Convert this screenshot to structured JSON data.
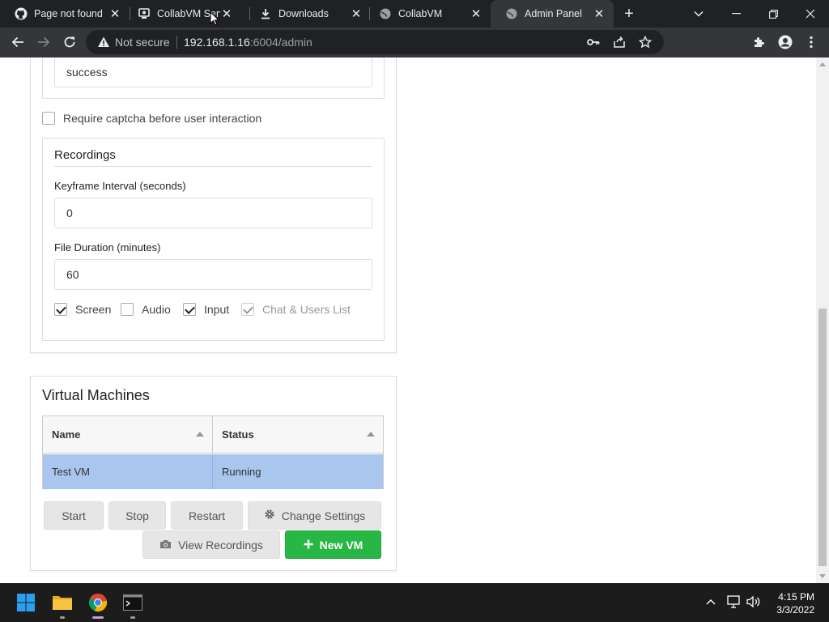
{
  "browser": {
    "tabs": [
      {
        "title": "Page not found",
        "icon": "github-icon"
      },
      {
        "title": "CollabVM Server",
        "icon": "collabvm-icon"
      },
      {
        "title": "Downloads",
        "icon": "download-icon"
      },
      {
        "title": "CollabVM",
        "icon": "globe-icon"
      },
      {
        "title": "Admin Panel",
        "icon": "globe-icon",
        "active": true
      }
    ],
    "not_secure": "Not secure",
    "url_host": "192.168.1.16",
    "url_rest": ":6004/admin"
  },
  "settings": {
    "auth_result_value": "success",
    "captcha_label": "Require captcha before user interaction",
    "captcha_checked": false
  },
  "recordings": {
    "title": "Recordings",
    "keyframe_label": "Keyframe Interval (seconds)",
    "keyframe_value": "0",
    "duration_label": "File Duration (minutes)",
    "duration_value": "60",
    "options": [
      {
        "label": "Screen",
        "checked": true,
        "disabled": false
      },
      {
        "label": "Audio",
        "checked": false,
        "disabled": false
      },
      {
        "label": "Input",
        "checked": true,
        "disabled": false
      },
      {
        "label": "Chat & Users List",
        "checked": true,
        "disabled": true
      }
    ]
  },
  "vms": {
    "title": "Virtual Machines",
    "columns": [
      "Name",
      "Status"
    ],
    "rows": [
      {
        "name": "Test VM",
        "status": "Running",
        "selected": true
      }
    ],
    "buttons": {
      "start": "Start",
      "stop": "Stop",
      "restart": "Restart",
      "change_settings": "Change Settings",
      "view_recordings": "View Recordings",
      "new_vm": "New VM"
    }
  },
  "taskbar": {
    "time": "4:15 PM",
    "date": "3/3/2022"
  },
  "colors": {
    "chrome_dark": "#202124",
    "chrome_toolbar": "#35363a",
    "selected_row": "#a8c6ee",
    "new_vm_green": "#28b745"
  }
}
